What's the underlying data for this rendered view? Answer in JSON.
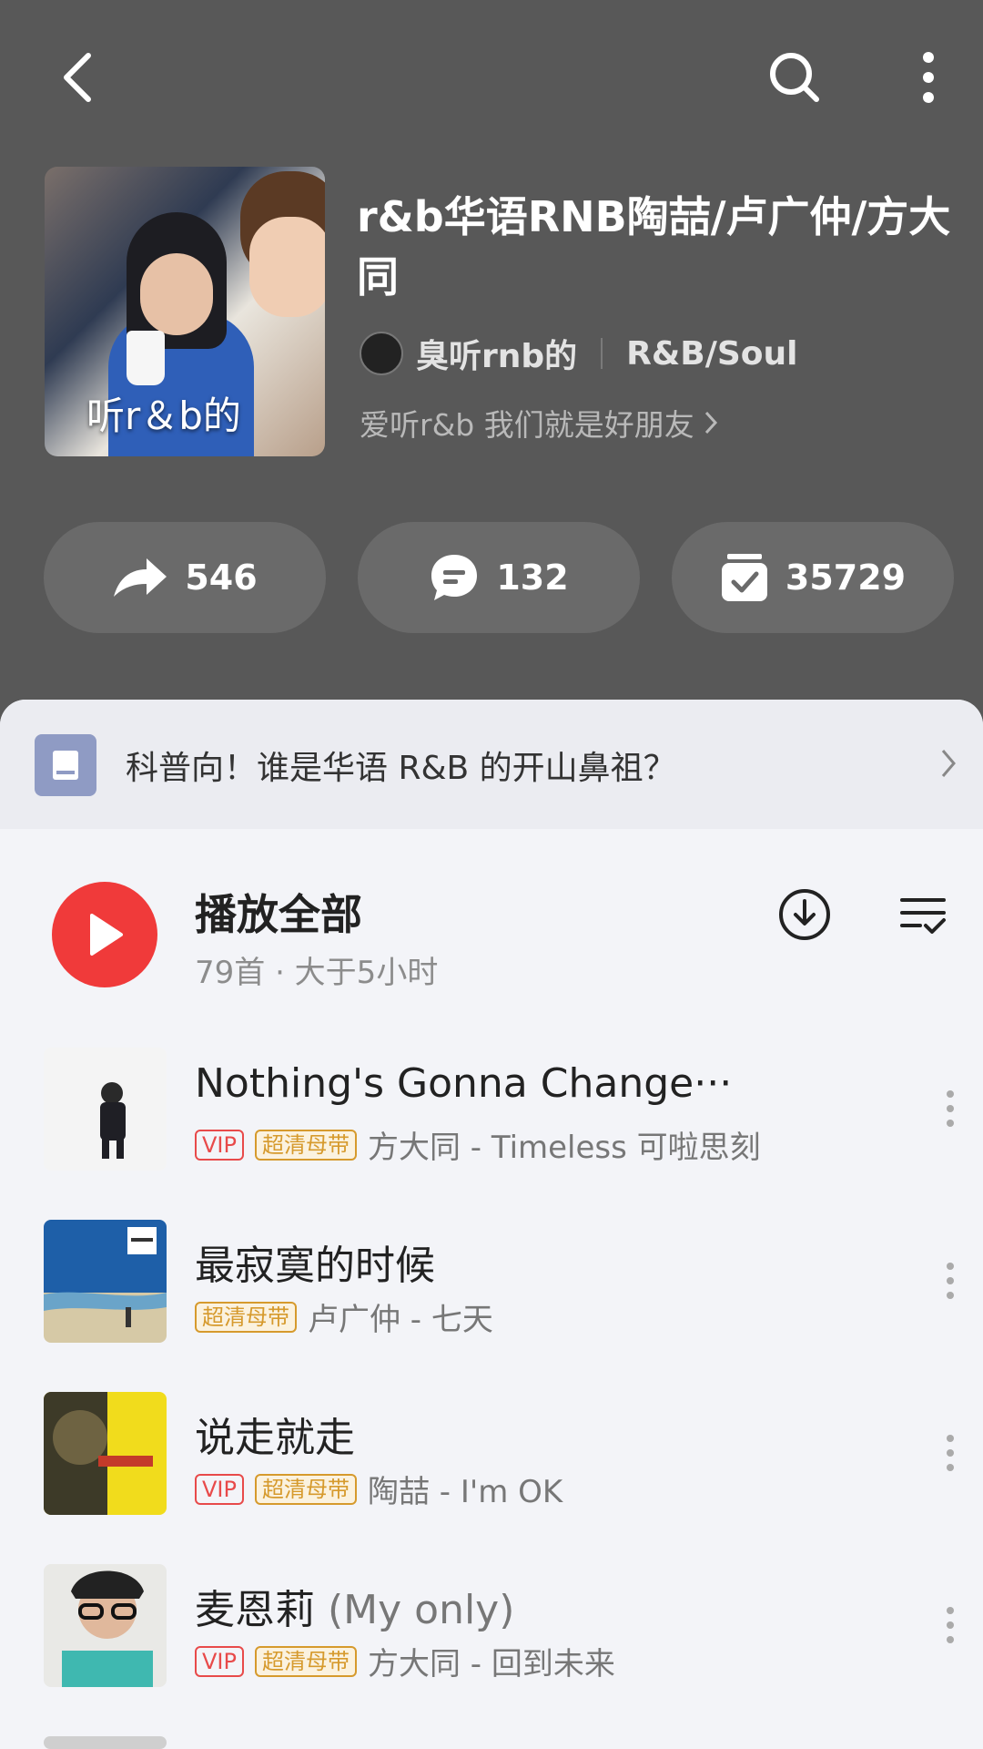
{
  "header": {
    "title": "r&b华语RNB陶喆/卢广仲/方大同",
    "cover_text": "听r＆b的",
    "creator_name": "臭听rnb的",
    "tag": "R&B/Soul",
    "description": "爱听r&b 我们就是好朋友",
    "icons": {
      "back": "back-arrow-icon",
      "search": "search-icon",
      "more": "more-vertical-icon"
    }
  },
  "stats": {
    "share": "546",
    "comments": "132",
    "collect": "35729"
  },
  "notice": {
    "text": "科普向！谁是华语 R&B 的开山鼻祖？"
  },
  "play_all": {
    "label": "播放全部",
    "sub": "79首 · 大于5小时"
  },
  "songs": [
    {
      "title": "Nothing's Gonna Change···",
      "title_extra": "",
      "vip": "VIP",
      "quality": "超清母带",
      "artist": "方大同 - Timeless 可啦思刻"
    },
    {
      "title": "最寂寞的时候",
      "title_extra": "",
      "vip": "",
      "quality": "超清母带",
      "artist": "卢广仲 - 七天"
    },
    {
      "title": "说走就走",
      "title_extra": "",
      "vip": "VIP",
      "quality": "超清母带",
      "artist": "陶喆 - I'm OK"
    },
    {
      "title": "麦恩莉 ",
      "title_extra": "(My only)",
      "vip": "VIP",
      "quality": "超清母带",
      "artist": "方大同 - 回到未来"
    }
  ],
  "colors": {
    "header_bg": "#585858",
    "accent_red": "#f03a3a",
    "vip": "#e84a4a",
    "quality": "#d69a2d"
  }
}
